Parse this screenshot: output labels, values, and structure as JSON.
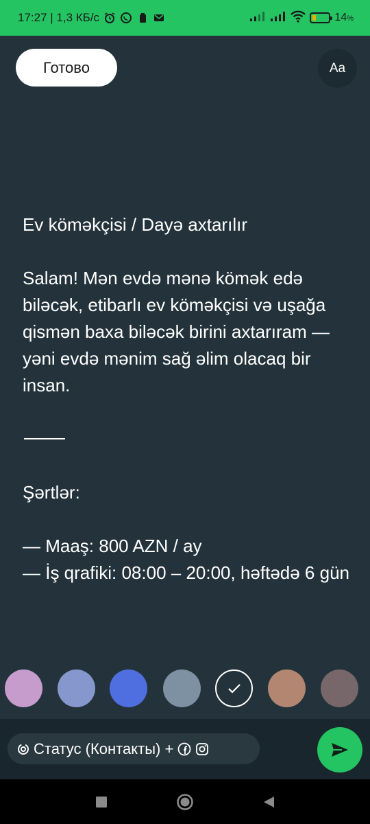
{
  "status_bar": {
    "time_speed": "17:27 | 1,3 КБ/с",
    "battery_pct": "14",
    "battery_level": 0.14,
    "battery_color": "#e6b400",
    "background": "#25c463"
  },
  "header": {
    "done_label": "Готово",
    "font_label": "Aa"
  },
  "content": {
    "title": "Ev köməkçisi / Dayə axtarılır",
    "intro": "Salam! Mən evdə mənə kömək edə biləcək, etibarlı ev köməkçisi və uşağa qismən baxa biləcək birini axtarıram — yəni evdə mənim sağ əlim olacaq bir insan.",
    "conditions_heading": "Şərtlər:",
    "conditions": [
      "— Maaş: 800 AZN / ay",
      "— İş qrafiki: 08:00 – 20:00, həftədə 6 gün"
    ]
  },
  "palette": {
    "colors": [
      "#c59ccc",
      "#8597cc",
      "#4f6ee0",
      "#7e91a3",
      "selected",
      "#b38672",
      "#77676b"
    ],
    "selected_index": 4
  },
  "bottom_bar": {
    "privacy_label": "Статус (Контакты) +",
    "icons": [
      "privacy-icon",
      "facebook-icon",
      "instagram-icon"
    ],
    "send_color": "#25c463"
  },
  "nav_bar": {
    "buttons": [
      "recents-button",
      "home-button",
      "back-button"
    ]
  }
}
